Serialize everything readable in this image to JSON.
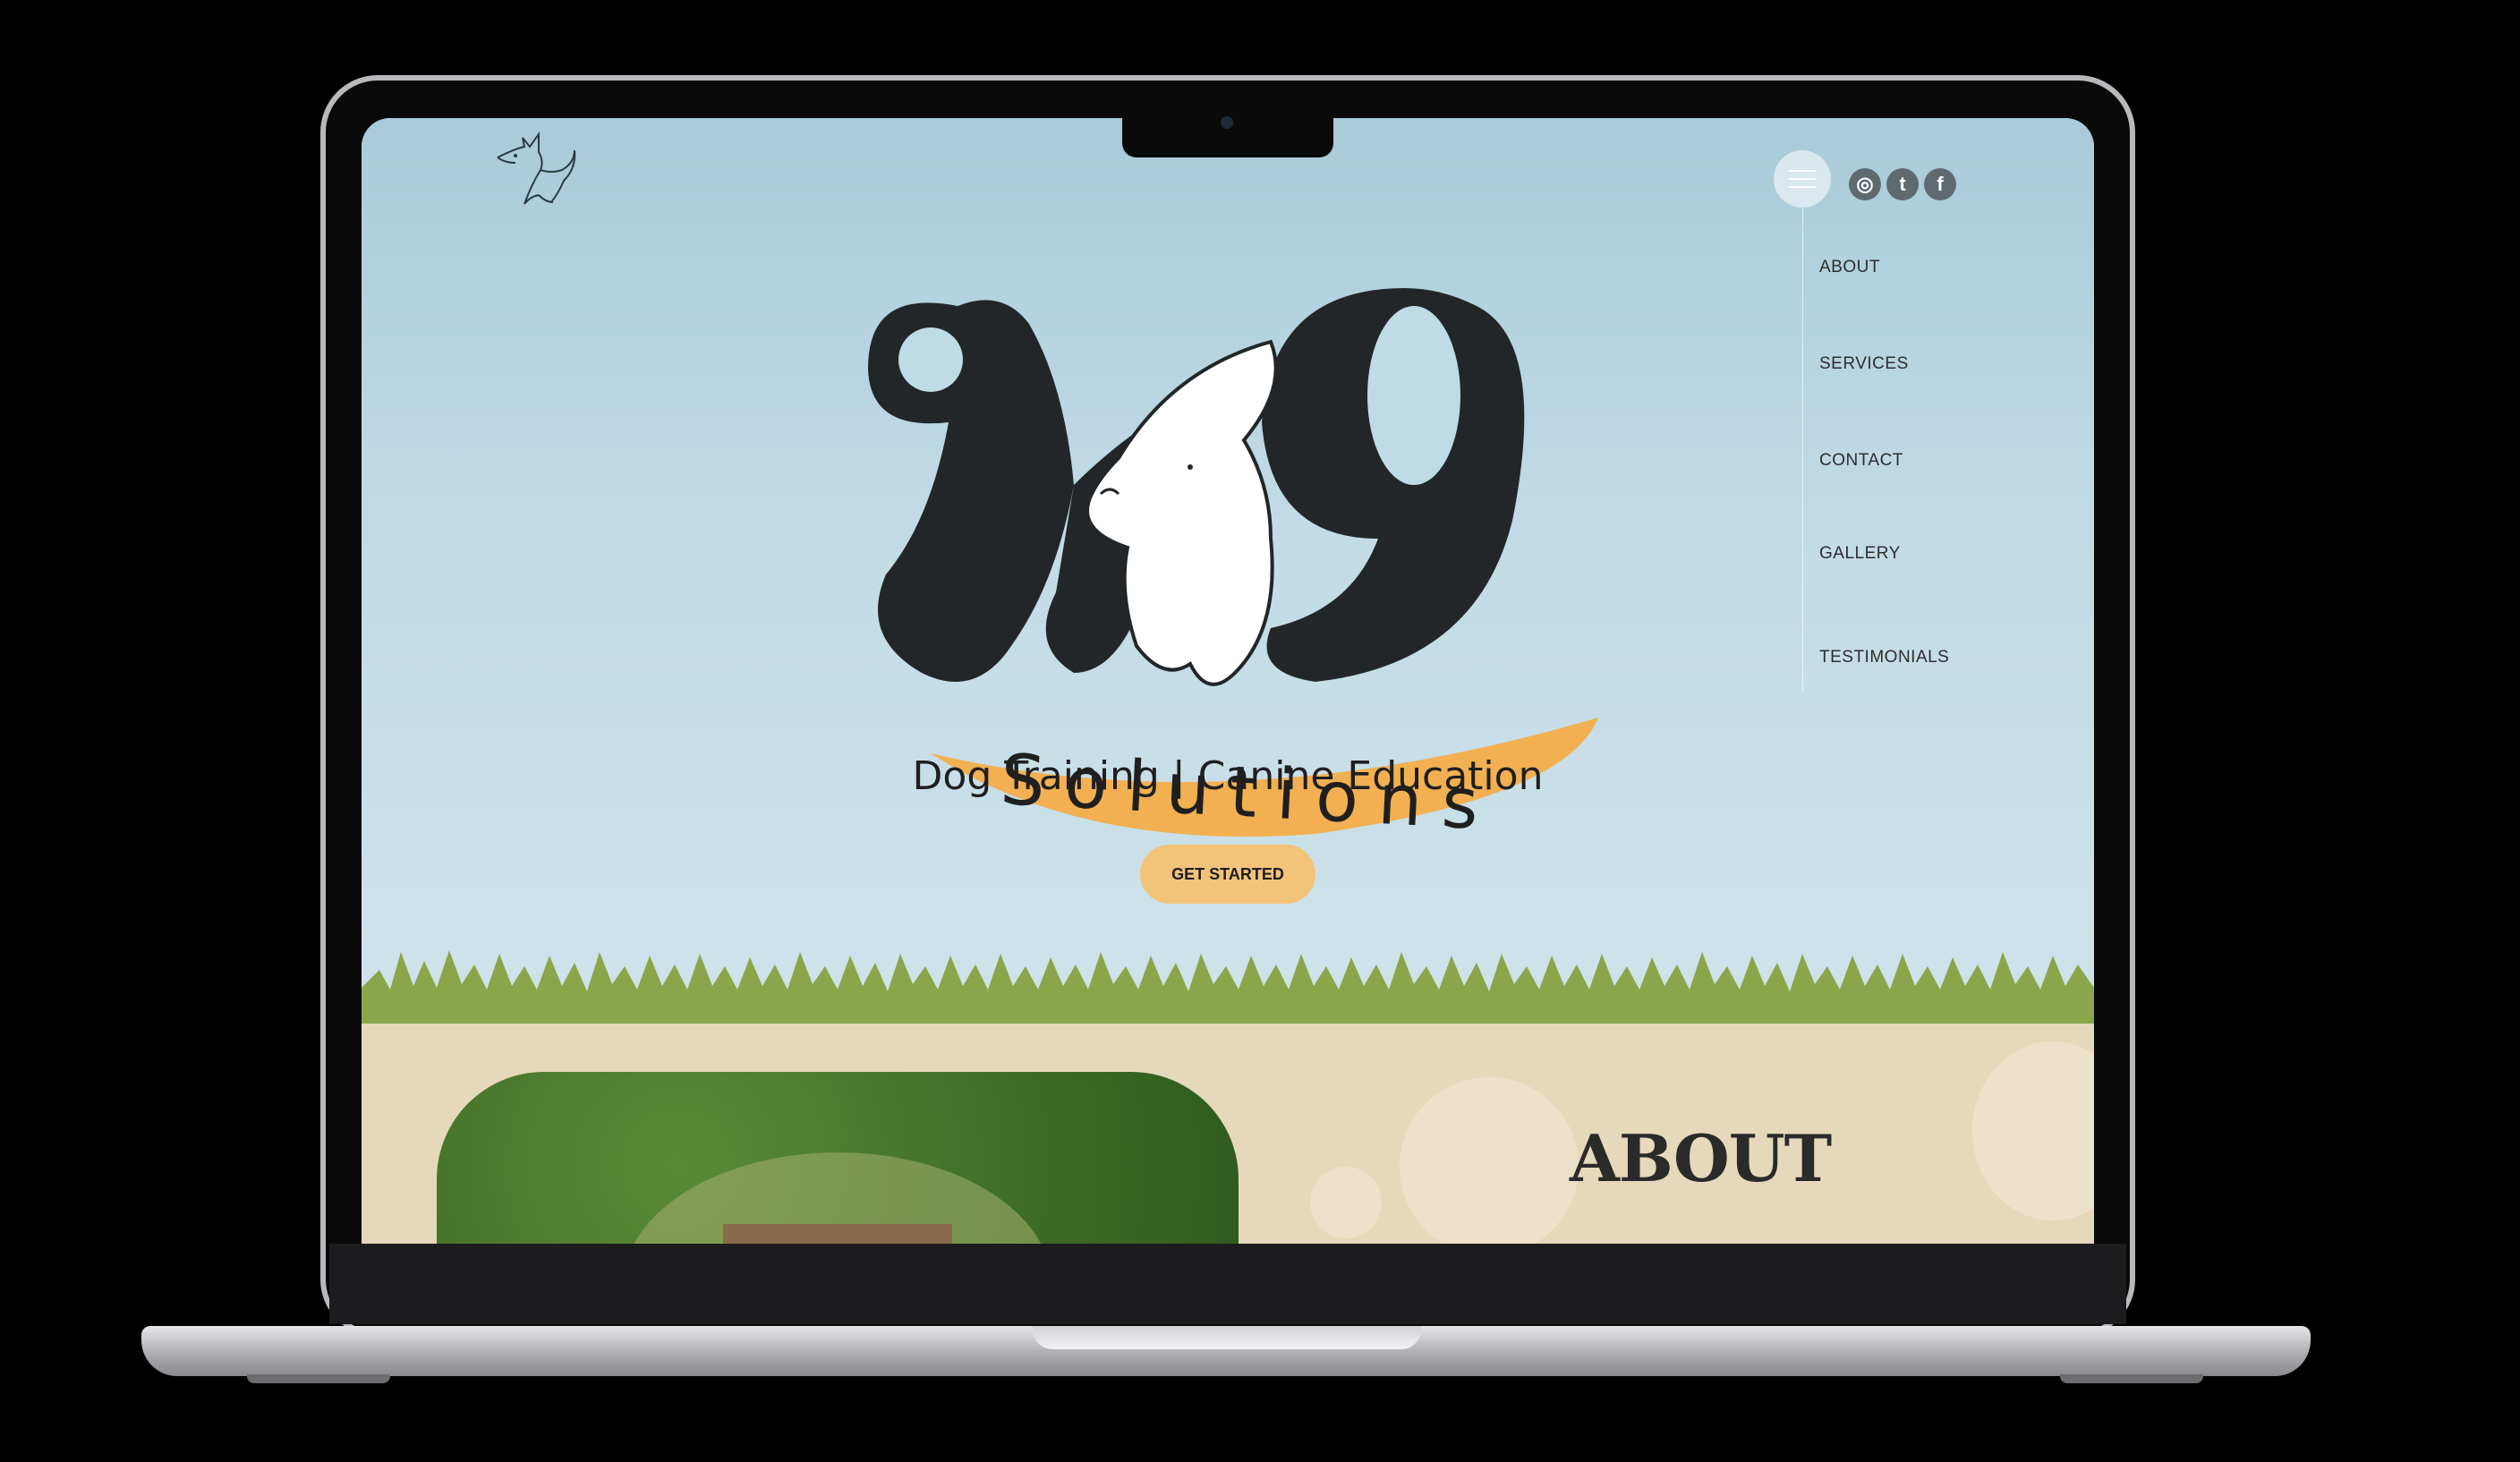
{
  "brand": {
    "wordmark_k9": "K9",
    "wordmark_solutions": "Solutions",
    "tagline": "Dog Training | Canine Education",
    "accent_color": "#f4c37a",
    "ink_color": "#222628"
  },
  "nav": {
    "menu_icon": "hamburger-icon",
    "items": [
      {
        "label": "ABOUT"
      },
      {
        "label": "SERVICES"
      },
      {
        "label": "CONTACT"
      },
      {
        "label": "GALLERY"
      },
      {
        "label": "TESTIMONIALS"
      }
    ]
  },
  "social": [
    {
      "icon": "instagram-icon",
      "glyph": "◎"
    },
    {
      "icon": "twitter-icon",
      "glyph": "t"
    },
    {
      "icon": "facebook-icon",
      "glyph": "f"
    }
  ],
  "hero": {
    "cta_label": "GET STARTED"
  },
  "about": {
    "title": "ABOUT"
  }
}
